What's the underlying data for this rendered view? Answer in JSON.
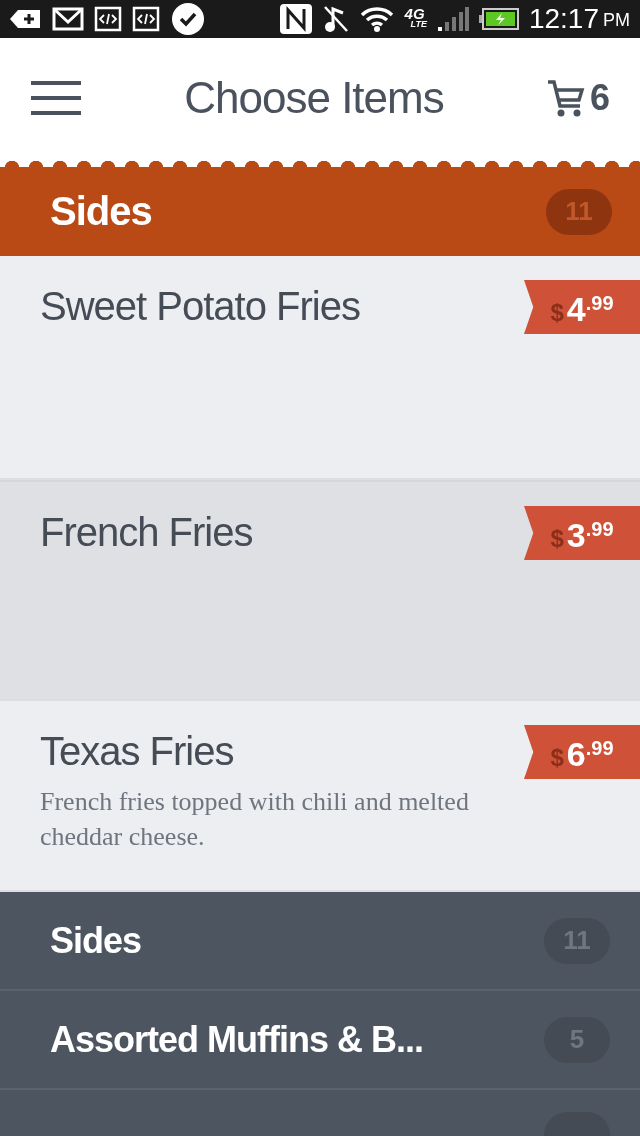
{
  "status_bar": {
    "network": "4G",
    "network_sub": "LTE",
    "time": "12:17",
    "meridiem": "PM"
  },
  "header": {
    "title": "Choose Items",
    "cart_count": "6"
  },
  "section": {
    "title": "Sides",
    "count": "11"
  },
  "items": [
    {
      "name": "Sweet Potato Fries",
      "selected": false,
      "price": {
        "currency": "$",
        "whole": "4",
        "cents": ".99"
      }
    },
    {
      "name": "French Fries",
      "selected": true,
      "price": {
        "currency": "$",
        "whole": "3",
        "cents": ".99"
      }
    },
    {
      "name": "Texas Fries",
      "description": "French fries topped with chili and melted cheddar cheese.",
      "selected": false,
      "price": {
        "currency": "$",
        "whole": "6",
        "cents": ".99"
      }
    }
  ],
  "categories": [
    {
      "title": "Sides",
      "count": "11"
    },
    {
      "title": "Assorted Muffins & B...",
      "count": "5"
    }
  ]
}
